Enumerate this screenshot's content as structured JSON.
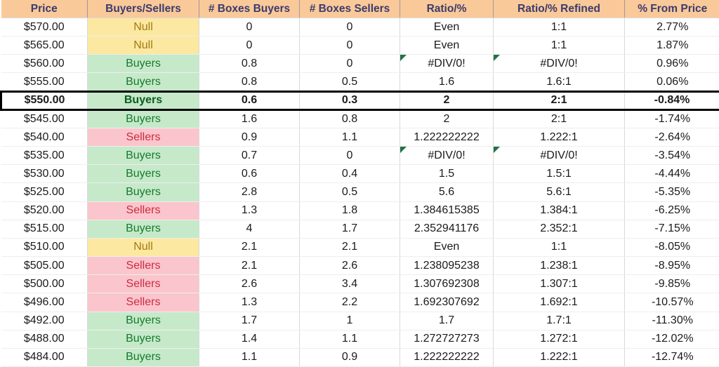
{
  "table": {
    "columns": [
      {
        "key": "price",
        "label": "Price"
      },
      {
        "key": "side",
        "label": "Buyers/Sellers"
      },
      {
        "key": "boxes_buyers",
        "label": "# Boxes Buyers"
      },
      {
        "key": "boxes_sellers",
        "label": "# Boxes Sellers"
      },
      {
        "key": "ratio",
        "label": "Ratio/%"
      },
      {
        "key": "ratio_refined",
        "label": "Ratio/% Refined"
      },
      {
        "key": "pct_from_price",
        "label": "% From Price"
      }
    ],
    "header_fill": "#FAC999",
    "header_text_color": "#3B3B6D",
    "fills": {
      "Null": "#FCE8A0",
      "Buyers": "#C6E9CA",
      "Sellers": "#FAC5CC"
    },
    "text_colors": {
      "Null": "#A07B16",
      "Buyers": "#157A2B",
      "Sellers": "#CF2A41"
    },
    "error_flag_color": "#217346",
    "highlight_border_color": "#000000",
    "rows": [
      {
        "price": "$570.00",
        "side": "Null",
        "boxes_buyers": "0",
        "boxes_sellers": "0",
        "ratio": "Even",
        "ratio_refined": "1:1",
        "pct_from_price": "2.77%",
        "highlight": false,
        "flag_ratio": false,
        "flag_refined": false
      },
      {
        "price": "$565.00",
        "side": "Null",
        "boxes_buyers": "0",
        "boxes_sellers": "0",
        "ratio": "Even",
        "ratio_refined": "1:1",
        "pct_from_price": "1.87%",
        "highlight": false,
        "flag_ratio": false,
        "flag_refined": false
      },
      {
        "price": "$560.00",
        "side": "Buyers",
        "boxes_buyers": "0.8",
        "boxes_sellers": "0",
        "ratio": "#DIV/0!",
        "ratio_refined": "#DIV/0!",
        "pct_from_price": "0.96%",
        "highlight": false,
        "flag_ratio": true,
        "flag_refined": true
      },
      {
        "price": "$555.00",
        "side": "Buyers",
        "boxes_buyers": "0.8",
        "boxes_sellers": "0.5",
        "ratio": "1.6",
        "ratio_refined": "1.6:1",
        "pct_from_price": "0.06%",
        "highlight": false,
        "flag_ratio": false,
        "flag_refined": false
      },
      {
        "price": "$550.00",
        "side": "Buyers",
        "boxes_buyers": "0.6",
        "boxes_sellers": "0.3",
        "ratio": "2",
        "ratio_refined": "2:1",
        "pct_from_price": "-0.84%",
        "highlight": true,
        "flag_ratio": false,
        "flag_refined": false
      },
      {
        "price": "$545.00",
        "side": "Buyers",
        "boxes_buyers": "1.6",
        "boxes_sellers": "0.8",
        "ratio": "2",
        "ratio_refined": "2:1",
        "pct_from_price": "-1.74%",
        "highlight": false,
        "flag_ratio": false,
        "flag_refined": false
      },
      {
        "price": "$540.00",
        "side": "Sellers",
        "boxes_buyers": "0.9",
        "boxes_sellers": "1.1",
        "ratio": "1.222222222",
        "ratio_refined": "1.222:1",
        "pct_from_price": "-2.64%",
        "highlight": false,
        "flag_ratio": false,
        "flag_refined": false
      },
      {
        "price": "$535.00",
        "side": "Buyers",
        "boxes_buyers": "0.7",
        "boxes_sellers": "0",
        "ratio": "#DIV/0!",
        "ratio_refined": "#DIV/0!",
        "pct_from_price": "-3.54%",
        "highlight": false,
        "flag_ratio": true,
        "flag_refined": true
      },
      {
        "price": "$530.00",
        "side": "Buyers",
        "boxes_buyers": "0.6",
        "boxes_sellers": "0.4",
        "ratio": "1.5",
        "ratio_refined": "1.5:1",
        "pct_from_price": "-4.44%",
        "highlight": false,
        "flag_ratio": false,
        "flag_refined": false
      },
      {
        "price": "$525.00",
        "side": "Buyers",
        "boxes_buyers": "2.8",
        "boxes_sellers": "0.5",
        "ratio": "5.6",
        "ratio_refined": "5.6:1",
        "pct_from_price": "-5.35%",
        "highlight": false,
        "flag_ratio": false,
        "flag_refined": false
      },
      {
        "price": "$520.00",
        "side": "Sellers",
        "boxes_buyers": "1.3",
        "boxes_sellers": "1.8",
        "ratio": "1.384615385",
        "ratio_refined": "1.384:1",
        "pct_from_price": "-6.25%",
        "highlight": false,
        "flag_ratio": false,
        "flag_refined": false
      },
      {
        "price": "$515.00",
        "side": "Buyers",
        "boxes_buyers": "4",
        "boxes_sellers": "1.7",
        "ratio": "2.352941176",
        "ratio_refined": "2.352:1",
        "pct_from_price": "-7.15%",
        "highlight": false,
        "flag_ratio": false,
        "flag_refined": false
      },
      {
        "price": "$510.00",
        "side": "Null",
        "boxes_buyers": "2.1",
        "boxes_sellers": "2.1",
        "ratio": "Even",
        "ratio_refined": "1:1",
        "pct_from_price": "-8.05%",
        "highlight": false,
        "flag_ratio": false,
        "flag_refined": false
      },
      {
        "price": "$505.00",
        "side": "Sellers",
        "boxes_buyers": "2.1",
        "boxes_sellers": "2.6",
        "ratio": "1.238095238",
        "ratio_refined": "1.238:1",
        "pct_from_price": "-8.95%",
        "highlight": false,
        "flag_ratio": false,
        "flag_refined": false
      },
      {
        "price": "$500.00",
        "side": "Sellers",
        "boxes_buyers": "2.6",
        "boxes_sellers": "3.4",
        "ratio": "1.307692308",
        "ratio_refined": "1.307:1",
        "pct_from_price": "-9.85%",
        "highlight": false,
        "flag_ratio": false,
        "flag_refined": false
      },
      {
        "price": "$496.00",
        "side": "Sellers",
        "boxes_buyers": "1.3",
        "boxes_sellers": "2.2",
        "ratio": "1.692307692",
        "ratio_refined": "1.692:1",
        "pct_from_price": "-10.57%",
        "highlight": false,
        "flag_ratio": false,
        "flag_refined": false
      },
      {
        "price": "$492.00",
        "side": "Buyers",
        "boxes_buyers": "1.7",
        "boxes_sellers": "1",
        "ratio": "1.7",
        "ratio_refined": "1.7:1",
        "pct_from_price": "-11.30%",
        "highlight": false,
        "flag_ratio": false,
        "flag_refined": false
      },
      {
        "price": "$488.00",
        "side": "Buyers",
        "boxes_buyers": "1.4",
        "boxes_sellers": "1.1",
        "ratio": "1.272727273",
        "ratio_refined": "1.272:1",
        "pct_from_price": "-12.02%",
        "highlight": false,
        "flag_ratio": false,
        "flag_refined": false
      },
      {
        "price": "$484.00",
        "side": "Buyers",
        "boxes_buyers": "1.1",
        "boxes_sellers": "0.9",
        "ratio": "1.222222222",
        "ratio_refined": "1.222:1",
        "pct_from_price": "-12.74%",
        "highlight": false,
        "flag_ratio": false,
        "flag_refined": false
      }
    ]
  }
}
